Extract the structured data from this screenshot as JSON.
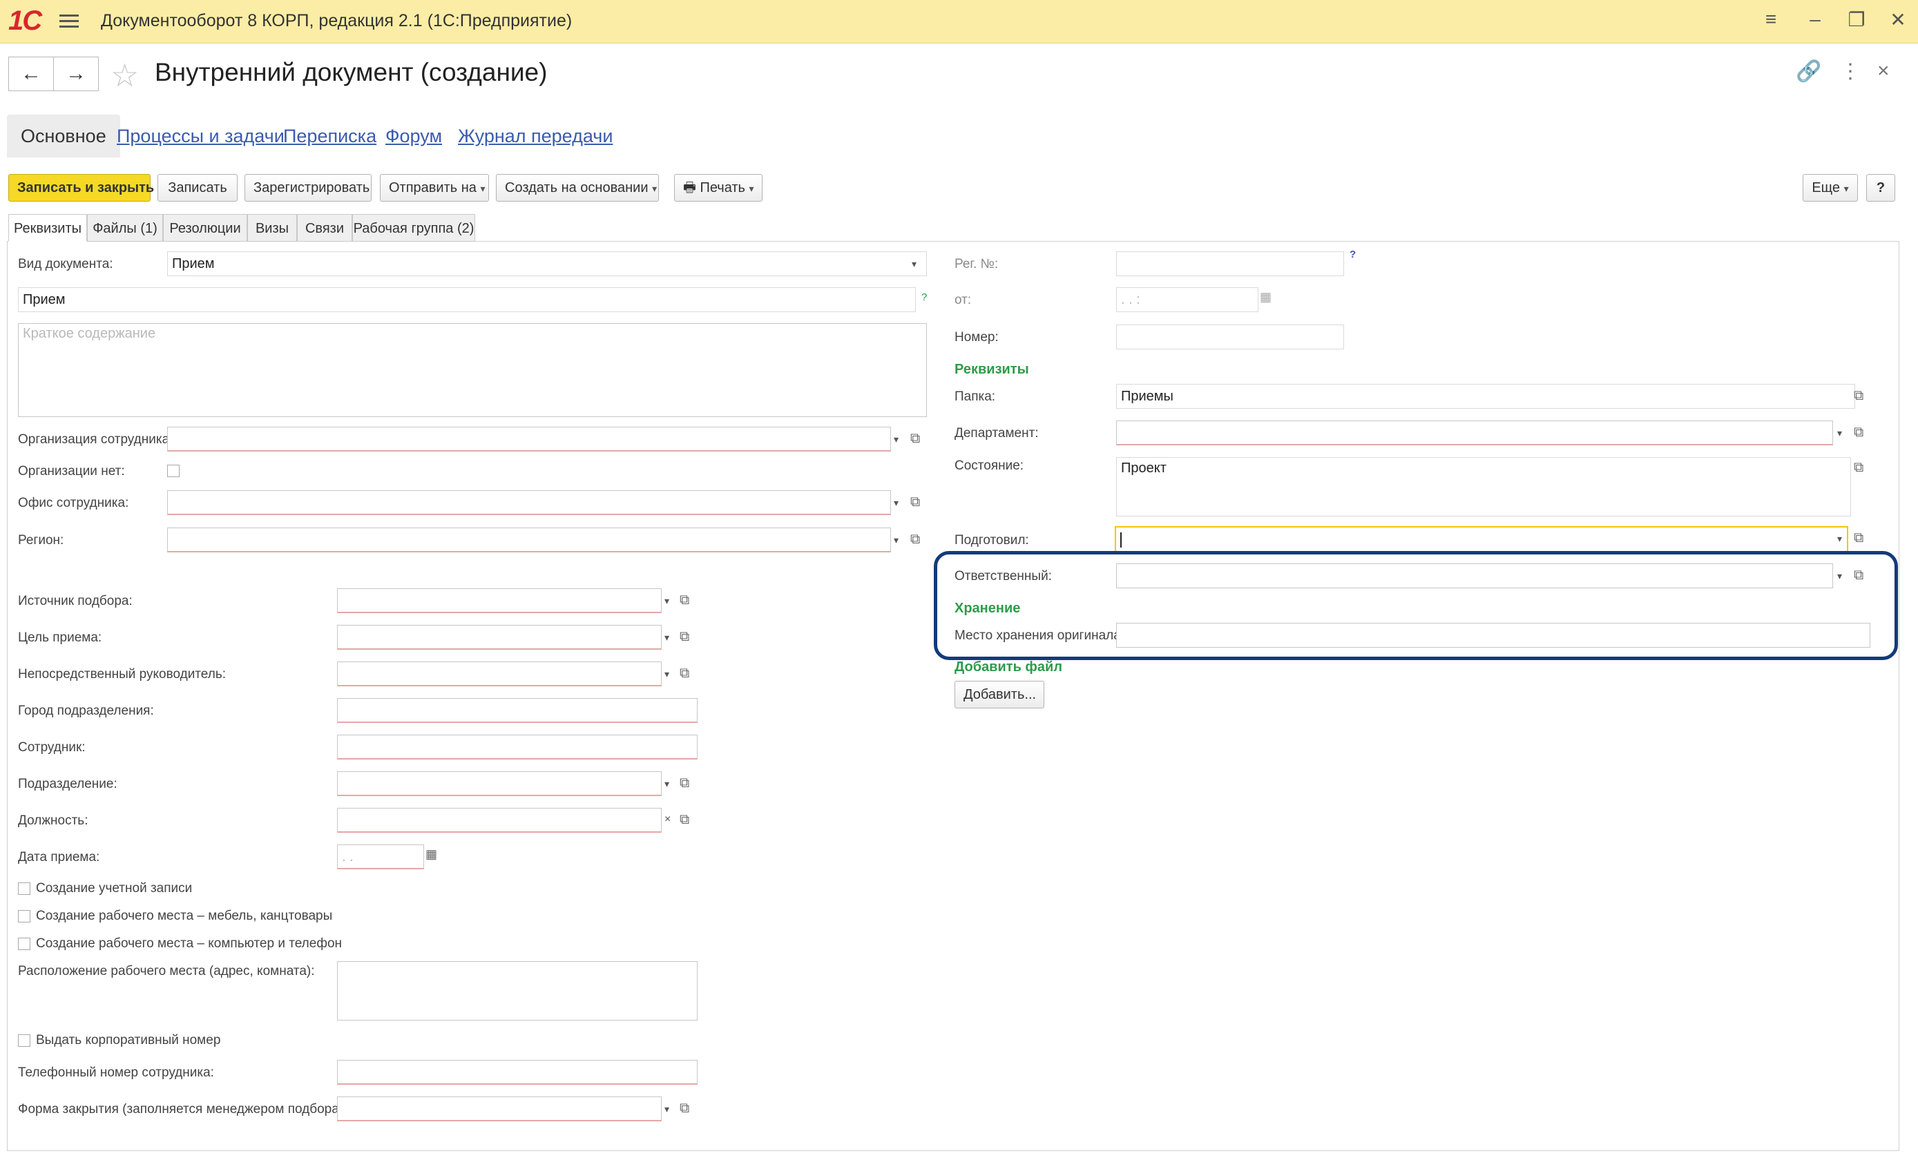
{
  "app": {
    "title": "Документооборот 8 КОРП, редакция 2.1 (1С:Предприятие)",
    "logo": "1С"
  },
  "window_controls": {
    "menu": "≡",
    "minimize": "–",
    "restore": "❐",
    "close": "✕"
  },
  "header": {
    "back": "←",
    "forward": "→",
    "favorite_icon": "star-icon",
    "title": "Внутренний документ (создание)",
    "link_icon": "link-icon",
    "more": "⋮",
    "close": "×"
  },
  "sections": [
    {
      "label": "Основное"
    },
    {
      "label": "Процессы и задачи"
    },
    {
      "label": "Переписка"
    },
    {
      "label": "Форум"
    },
    {
      "label": "Журнал передачи"
    }
  ],
  "toolbar": {
    "save_close": "Записать и закрыть",
    "save": "Записать",
    "register": "Зарегистрировать",
    "send": "Отправить на",
    "create_based": "Создать на основании",
    "print": "Печать",
    "more": "Еще",
    "help": "?"
  },
  "subtabs": [
    "Реквизиты",
    "Файлы (1)",
    "Резолюции",
    "Визы",
    "Связи",
    "Рабочая группа (2)"
  ],
  "left": {
    "doc_type_label": "Вид документа:",
    "doc_type_value": "Прием",
    "title_value": "Прием",
    "summary_placeholder": "Краткое содержание",
    "org_label": "Организация сотрудника:",
    "no_org_label": "Организации нет:",
    "office_label": "Офис сотрудника:",
    "region_label": "Регион:",
    "source_label": "Источник подбора:",
    "goal_label": "Цель приема:",
    "manager_label": "Непосредственный руководитель:",
    "city_label": "Город подразделения:",
    "employee_label": "Сотрудник:",
    "department_label": "Подразделение:",
    "position_label": "Должность:",
    "hire_date_label": "Дата приема:",
    "hire_date_placeholder": ". .",
    "cb_account": "Создание учетной записи",
    "cb_furniture": "Создание рабочего места – мебель, канцтовары",
    "cb_computer": "Создание рабочего места – компьютер и телефон",
    "workplace_label": "Расположение рабочего места (адрес, комната):",
    "cb_corp_number": "Выдать корпоративный номер",
    "phone_label": "Телефонный номер сотрудника:",
    "closing_form_label": "Форма закрытия (заполняется менеджером подбора):"
  },
  "right": {
    "reg_no_label": "Рег. №:",
    "from_label": "от:",
    "from_placeholder": ". .   :",
    "number_label": "Номер:",
    "group_requisites": "Реквизиты",
    "folder_label": "Папка:",
    "folder_value": "Приемы",
    "department_label": "Департамент:",
    "state_label": "Состояние:",
    "state_value": "Проект",
    "prepared_label": "Подготовил:",
    "responsible_label": "Ответственный:",
    "group_storage": "Хранение",
    "storage_label": "Место хранения оригинала:",
    "group_add_file": "Добавить файл",
    "add_button": "Добавить..."
  },
  "colors": {
    "titlebar": "#fbeda6",
    "primary_button": "#f5d925",
    "link": "#3b5cad",
    "group_title": "#2e9b4b",
    "highlight": "#133a7c",
    "required_underline": "#e6a7a7"
  }
}
